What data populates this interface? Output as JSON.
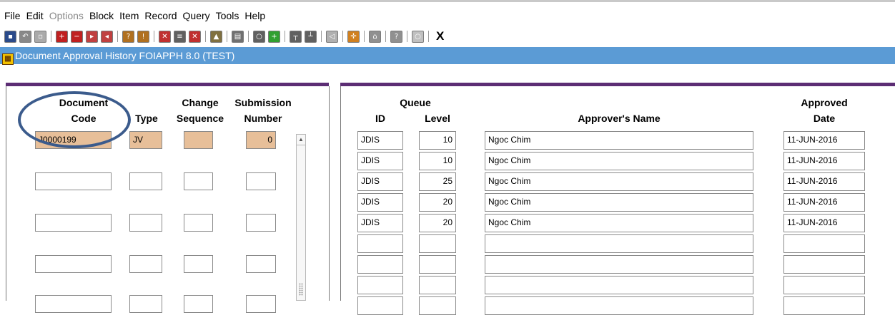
{
  "menu": [
    {
      "label": "File",
      "disabled": false
    },
    {
      "label": "Edit",
      "disabled": false
    },
    {
      "label": "Options",
      "disabled": true
    },
    {
      "label": "Block",
      "disabled": false
    },
    {
      "label": "Item",
      "disabled": false
    },
    {
      "label": "Record",
      "disabled": false
    },
    {
      "label": "Query",
      "disabled": false
    },
    {
      "label": "Tools",
      "disabled": false
    },
    {
      "label": "Help",
      "disabled": false
    }
  ],
  "toolbar": {
    "groups": [
      [
        {
          "icon": "save-icon",
          "color": "#2a4a8a"
        },
        {
          "icon": "rollback-icon",
          "color": "#888888"
        },
        {
          "icon": "print-page-icon",
          "color": "#aaaaaa"
        }
      ],
      [
        {
          "icon": "insert-record-icon",
          "color": "#c02020"
        },
        {
          "icon": "remove-record-icon",
          "color": "#c02020"
        },
        {
          "icon": "next-block-icon",
          "color": "#c04040"
        },
        {
          "icon": "previous-block-icon",
          "color": "#c04040"
        }
      ],
      [
        {
          "icon": "enter-query-icon",
          "color": "#b07020"
        },
        {
          "icon": "execute-query-icon",
          "color": "#b07020"
        }
      ],
      [
        {
          "icon": "cancel-query-icon",
          "color": "#c03030"
        },
        {
          "icon": "database-icon",
          "color": "#606060"
        },
        {
          "icon": "delete-icon",
          "color": "#c03030"
        }
      ],
      [
        {
          "icon": "attachment-icon",
          "color": "#807040"
        }
      ],
      [
        {
          "icon": "print-icon",
          "color": "#707070"
        }
      ],
      [
        {
          "icon": "search-icon",
          "color": "#606060"
        },
        {
          "icon": "add-icon",
          "color": "#30a030"
        }
      ],
      [
        {
          "icon": "hierarchy-icon",
          "color": "#606060"
        },
        {
          "icon": "hierarchy-down-icon",
          "color": "#606060"
        }
      ],
      [
        {
          "icon": "speaker-icon",
          "color": "#b0b0b0"
        }
      ],
      [
        {
          "icon": "target-icon",
          "color": "#d08020"
        }
      ],
      [
        {
          "icon": "bookmark-icon",
          "color": "#909090"
        }
      ],
      [
        {
          "icon": "help-icon",
          "color": "#909090"
        }
      ],
      [
        {
          "icon": "lightbulb-icon",
          "color": "#c0c0c0"
        }
      ]
    ],
    "exit_label": "X"
  },
  "title": "Document Approval History  FOIAPPH  8.0  (TEST)",
  "left": {
    "headers": {
      "doc_line1": "Document",
      "doc_line2": "Code",
      "type": "Type",
      "change_line1": "Change",
      "change_line2": "Sequence",
      "sub_line1": "Submission",
      "sub_line2": "Number"
    },
    "record": {
      "doc_code": "J0000199",
      "type": "JV",
      "change_seq": "",
      "sub_number": "0"
    }
  },
  "right": {
    "headers": {
      "queue": "Queue",
      "id": "ID",
      "level": "Level",
      "approver": "Approver's Name",
      "approved_line1": "Approved",
      "approved_line2": "Date"
    },
    "rows": [
      {
        "id": "JDIS",
        "level": "10",
        "name": "Ngoc Chim",
        "date": "11-JUN-2016"
      },
      {
        "id": "JDIS",
        "level": "10",
        "name": "Ngoc Chim",
        "date": "11-JUN-2016"
      },
      {
        "id": "JDIS",
        "level": "25",
        "name": "Ngoc Chim",
        "date": "11-JUN-2016"
      },
      {
        "id": "JDIS",
        "level": "20",
        "name": "Ngoc Chim",
        "date": "11-JUN-2016"
      },
      {
        "id": "JDIS",
        "level": "20",
        "name": "Ngoc Chim",
        "date": "11-JUN-2016"
      },
      {
        "id": "",
        "level": "",
        "name": "",
        "date": ""
      },
      {
        "id": "",
        "level": "",
        "name": "",
        "date": ""
      },
      {
        "id": "",
        "level": "",
        "name": "",
        "date": ""
      },
      {
        "id": "",
        "level": "",
        "name": "",
        "date": ""
      }
    ]
  }
}
